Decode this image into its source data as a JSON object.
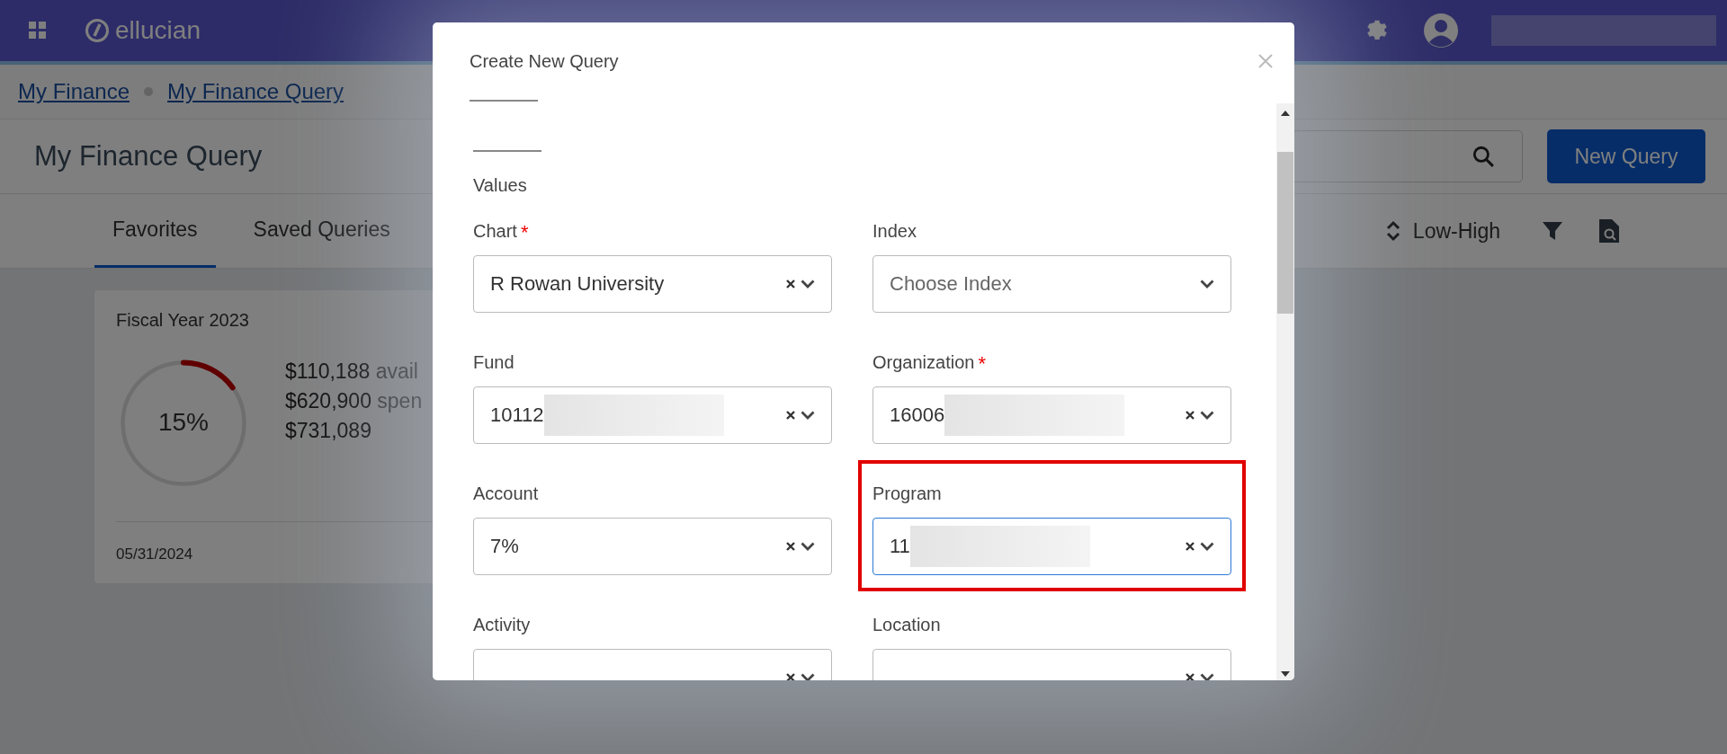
{
  "header": {
    "logo": "ellucian"
  },
  "breadcrumbs": [
    "My Finance",
    "My Finance Query"
  ],
  "page_title": "My Finance Query",
  "new_query_button": "New Query",
  "tabs": [
    {
      "label": "Favorites",
      "selected": true
    },
    {
      "label": "Saved Queries",
      "selected": false
    }
  ],
  "sort": {
    "label": "Low-High"
  },
  "card": {
    "title": "Fiscal Year 2023",
    "level": 0.15,
    "percent": "15%",
    "lines": [
      {
        "amount": "$110,188",
        "label": "avail"
      },
      {
        "amount": "$620,900",
        "label": "spen"
      },
      {
        "amount": "$731,089"
      }
    ],
    "date": "05/31/2024"
  },
  "modal": {
    "title": "Create New Query",
    "section": "Values",
    "fields": [
      {
        "label": "Chart",
        "required_mark": "*",
        "value": "R Rowan University",
        "clearable": true,
        "redacted": false,
        "focused": false,
        "highlighted": false
      },
      {
        "label": "Index",
        "placeholder": "Choose Index",
        "clearable": false,
        "redacted": false,
        "focused": false,
        "highlighted": false
      },
      {
        "label": "Fund",
        "value": "10112",
        "clearable": true,
        "redacted": true,
        "focused": false,
        "highlighted": false
      },
      {
        "label": "Organization",
        "required_mark": "*",
        "value": "16006",
        "clearable": true,
        "redacted": true,
        "focused": false,
        "highlighted": false
      },
      {
        "label": "Account",
        "value": "7%",
        "clearable": true,
        "redacted": false,
        "focused": false,
        "highlighted": false
      },
      {
        "label": "Program",
        "value": "11",
        "clearable": true,
        "redacted": true,
        "focused": true,
        "highlighted": true
      },
      {
        "label": "Activity",
        "clearable": true,
        "redacted": false,
        "focused": false,
        "highlighted": false
      },
      {
        "label": "Location",
        "clearable": true,
        "redacted": false,
        "focused": false,
        "highlighted": false
      }
    ]
  }
}
